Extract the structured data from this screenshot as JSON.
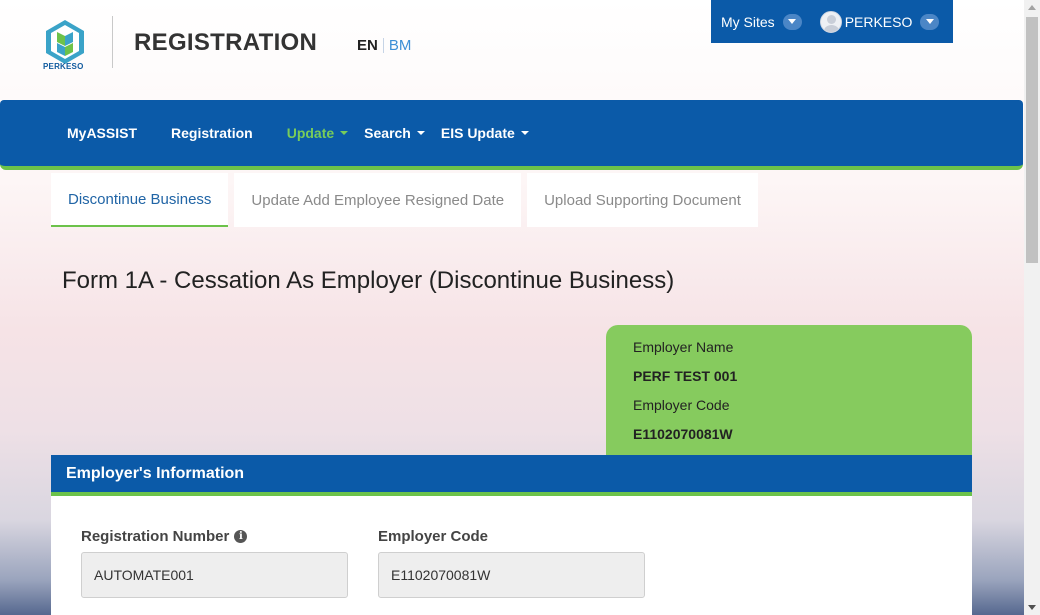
{
  "header": {
    "logo_text": "PERKESO",
    "app_title": "REGISTRATION",
    "lang_en": "EN",
    "lang_bm": "BM"
  },
  "topbar": {
    "my_sites": "My Sites",
    "user": "PERKESO"
  },
  "nav": {
    "items": [
      {
        "label": "MyASSIST"
      },
      {
        "label": "Registration"
      },
      {
        "label": "Update"
      },
      {
        "label": "Search"
      },
      {
        "label": "EIS Update"
      }
    ],
    "active": "Update",
    "active_color": "#78cc5a"
  },
  "tabs": [
    {
      "label": "Discontinue Business"
    },
    {
      "label": "Update Add Employee Resigned Date"
    },
    {
      "label": "Upload Supporting Document"
    }
  ],
  "form_title": "Form 1A - Cessation As Employer (Discontinue Business)",
  "employer_card": {
    "name_label": "Employer Name",
    "name_value": "PERF TEST 001",
    "code_label": "Employer Code",
    "code_value": "E1102070081W"
  },
  "section": {
    "title": "Employer's Information",
    "fields": [
      {
        "label": "Registration Number",
        "value": "AUTOMATE001"
      },
      {
        "label": "Employer Code",
        "value": "E1102070081W"
      }
    ]
  },
  "colors": {
    "primary_blue": "#0b5aa8",
    "accent_green": "#6cc24a",
    "card_green": "#86cb5e"
  }
}
